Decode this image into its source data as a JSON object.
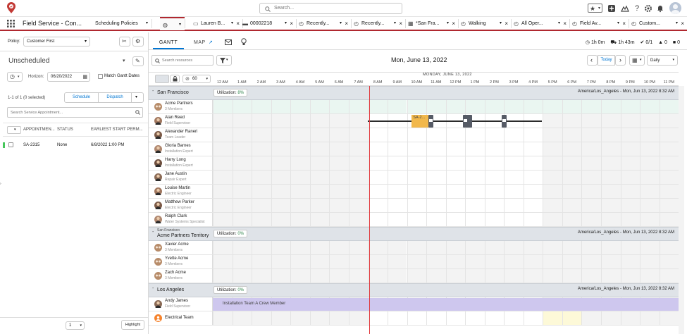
{
  "colors": {
    "accent": "#0176d3",
    "brand_red": "#b0282f",
    "now_line": "#e03a3e",
    "bar_gray": "#565b66",
    "service_yellow": "#f2b84b",
    "crew_purple": "#cec7ee"
  },
  "topbar": {
    "search_placeholder": "Search..."
  },
  "nav": {
    "app_name": "Field Service - Con...",
    "tabs": [
      {
        "label": "Scheduling Policies",
        "icon": "",
        "closable": false
      },
      {
        "label": "",
        "icon": "more-icon",
        "closable": false
      },
      {
        "label": "Lauren B...",
        "icon": "contact-icon",
        "closable": true
      },
      {
        "label": "00002218",
        "icon": "case-icon",
        "closable": true
      },
      {
        "label": "Recently...",
        "icon": "history-icon",
        "closable": true
      },
      {
        "label": "Recently...",
        "icon": "history-icon",
        "closable": true
      },
      {
        "label": "*San Fra...",
        "icon": "calendar-icon",
        "closable": true
      },
      {
        "label": "Walking",
        "icon": "history-icon",
        "closable": true
      },
      {
        "label": "All Oper...",
        "icon": "history-icon",
        "closable": true
      },
      {
        "label": "Field Av...",
        "icon": "history-icon",
        "closable": true
      },
      {
        "label": "Custom...",
        "icon": "history-icon",
        "closable": true
      }
    ]
  },
  "left": {
    "policy_label": "Policy:",
    "policy_value": "Customer First",
    "list_title": "Unscheduled",
    "horizon_label": "Horizon:",
    "horizon_value": "06/20/2022",
    "match_gantt_label": "Match Gantt Dates",
    "selected_count": "1-1 of 1 (0 selected)",
    "schedule_label": "Schedule",
    "dispatch_label": "Dispatch",
    "search_placeholder": "Search Service Appointment...",
    "columns": [
      "APPOINTMEN...",
      "STATUS",
      "EARLIEST START PERM..."
    ],
    "rows": [
      {
        "id": "SA-2315",
        "status": "None",
        "earliest": "6/8/2022 1:00 PM"
      }
    ],
    "page_value": "1",
    "highlight_label": "Highlight"
  },
  "gantt": {
    "tab_gantt": "GANTT",
    "tab_map": "MAP",
    "kpis": [
      {
        "icon": "clock-icon",
        "value": "1h 0m"
      },
      {
        "icon": "car-icon",
        "value": "1h 43m"
      },
      {
        "icon": "check-circle-icon",
        "value": "0/1"
      },
      {
        "icon": "warning-icon",
        "value": "0"
      },
      {
        "icon": "lock-icon",
        "value": "0"
      }
    ],
    "search_resources_placeholder": "Search resources",
    "date_title": "Mon, June 13, 2022",
    "today_label": "Today",
    "view_value": "Daily",
    "slot_value": "60",
    "day_header": "MONDAY, JUNE 13, 2022",
    "hours": [
      "12 AM",
      "1 AM",
      "2 AM",
      "3 AM",
      "4 AM",
      "5 AM",
      "6 AM",
      "7 AM",
      "8 AM",
      "9 AM",
      "10 AM",
      "11 AM",
      "12 PM",
      "1 PM",
      "2 PM",
      "3 PM",
      "4 PM",
      "5 PM",
      "6 PM",
      "7 PM",
      "8 PM",
      "9 PM",
      "10 PM",
      "11 PM"
    ],
    "now_hour": 8.05,
    "sections": [
      {
        "parent": "",
        "title": "San Francisco",
        "utilization_label": "Utilization:",
        "utilization_value": "8%",
        "tz": "America/Los_Angeles - Mon, Jun 13, 2022 8:32 AM",
        "resources": [
          {
            "name": "Acme Partners",
            "sub": "3 Members",
            "avatar": "crew"
          },
          {
            "name": "Alan Reed",
            "sub": "Field Supervisor",
            "avatar": "person"
          },
          {
            "name": "Alexander Raneri",
            "sub": "Team Leader",
            "avatar": "person"
          },
          {
            "name": "Gloria Barnes",
            "sub": "Installation Expert",
            "avatar": "person"
          },
          {
            "name": "Harry Long",
            "sub": "Installation Expert",
            "avatar": "person"
          },
          {
            "name": "Jane Austin",
            "sub": "Repair Expert",
            "avatar": "person"
          },
          {
            "name": "Louise Martin",
            "sub": "Electric Engineer",
            "avatar": "person"
          },
          {
            "name": "Matthew Parker",
            "sub": "Electric Engineer",
            "avatar": "person"
          },
          {
            "name": "Ralph Clark",
            "sub": "Water Systems Specialist",
            "avatar": "person"
          }
        ]
      },
      {
        "parent": "San Francisco",
        "title": "Acme Partners Territory",
        "utilization_label": "Utilization:",
        "utilization_value": "0%",
        "tz": "America/Los_Angeles - Mon, Jun 13, 2022 8:32 AM",
        "resources": [
          {
            "name": "Xavier Acme",
            "sub": "3 Members",
            "avatar": "crew"
          },
          {
            "name": "Yvette Acme",
            "sub": "3 Members",
            "avatar": "crew"
          },
          {
            "name": "Zach Acme",
            "sub": "3 Members",
            "avatar": "crew"
          }
        ]
      },
      {
        "parent": "",
        "title": "Los Angeles",
        "utilization_label": "Utilization:",
        "utilization_value": "0%",
        "tz": "America/Los_Angeles - Mon, Jun 13, 2022 8:32 AM",
        "resources": [
          {
            "name": "Andy James",
            "sub": "Field Supervisor",
            "avatar": "person"
          },
          {
            "name": "Electrical Team",
            "sub": "",
            "avatar": "team"
          }
        ]
      }
    ],
    "events": [
      {
        "section": 0,
        "row": 1,
        "type": "travel-line",
        "start": 8.0,
        "end": 16.95
      },
      {
        "section": 0,
        "row": 1,
        "type": "service",
        "label": "SA-2...",
        "start": 10.25,
        "end": 11.1
      },
      {
        "section": 0,
        "row": 1,
        "type": "break",
        "start": 11.1,
        "end": 11.35
      },
      {
        "section": 0,
        "row": 1,
        "type": "break",
        "start": 12.9,
        "end": 13.35
      },
      {
        "section": 0,
        "row": 1,
        "type": "break",
        "start": 14.9,
        "end": 15.15
      },
      {
        "section": 2,
        "row": 0,
        "type": "crew",
        "label": "Installation Team A Crew Member",
        "start": 0,
        "end": 24
      }
    ]
  }
}
